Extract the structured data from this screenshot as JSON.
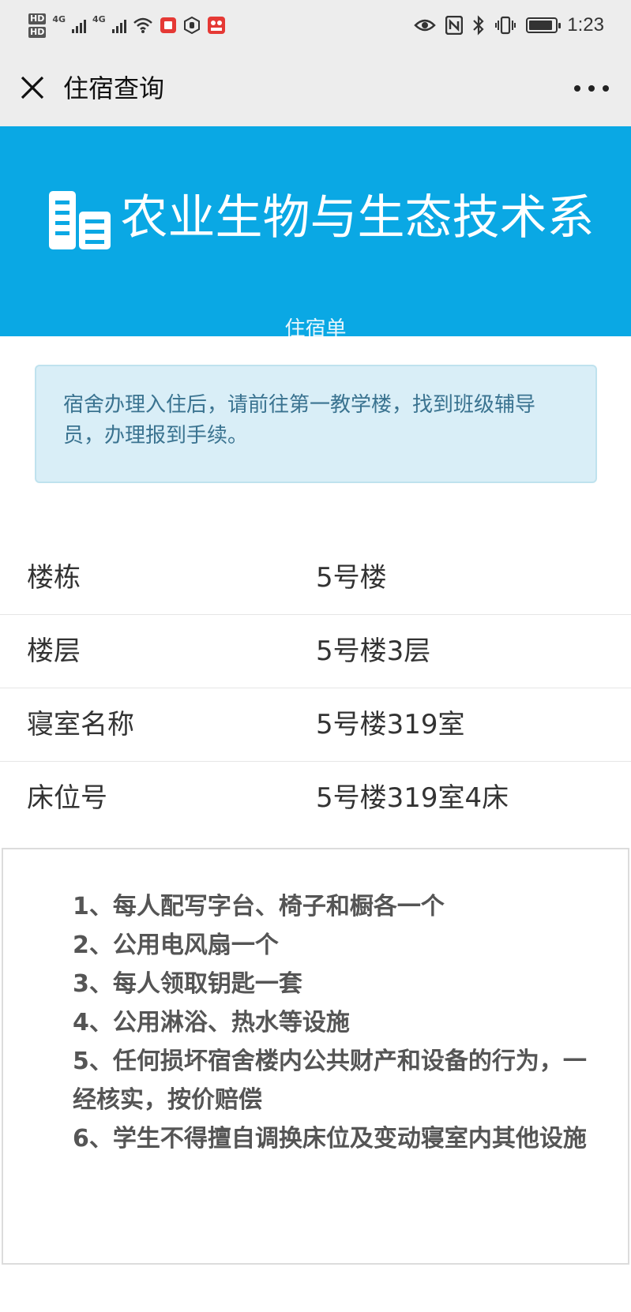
{
  "status_bar": {
    "sim1": "HD",
    "sim2": "HD",
    "network1": "4G",
    "network2": "4G",
    "time": "1:23",
    "battery_level": 0.9
  },
  "nav": {
    "title": "住宿查询"
  },
  "banner": {
    "title": "农业生物与生态技术系",
    "subtitle": "住宿单"
  },
  "notice": {
    "text": "宿舍办理入住后，请前往第一教学楼，找到班级辅导员，办理报到手续。"
  },
  "info": {
    "rows": [
      {
        "label": "楼栋",
        "value": "5号楼"
      },
      {
        "label": "楼层",
        "value": "5号楼3层"
      },
      {
        "label": "寝室名称",
        "value": "5号楼319室"
      },
      {
        "label": "床位号",
        "value": "5号楼319室4床"
      }
    ]
  },
  "rules": {
    "items": [
      "1、每人配写字台、椅子和橱各一个",
      "2、公用电风扇一个",
      "3、每人领取钥匙一套",
      "4、公用淋浴、热水等设施",
      "5、任何损坏宿舍楼内公共财产和设备的行为，一经核实，按价赔偿",
      "6、学生不得擅自调换床位及变动寝室内其他设施"
    ]
  },
  "colors": {
    "banner": "#0aa8e4",
    "notice_bg": "#d9eef7",
    "notice_text": "#3a7390",
    "nav_bg": "#ededed"
  }
}
